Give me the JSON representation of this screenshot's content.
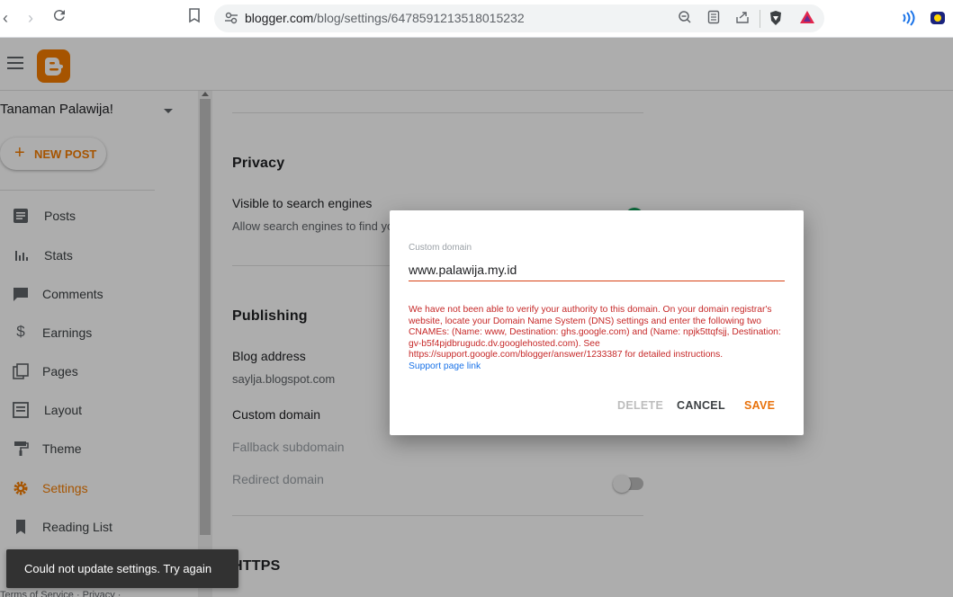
{
  "browser": {
    "url_host": "blogger.com",
    "url_path": "/blog/settings/6478591213518015232"
  },
  "sidebar": {
    "blog_name": "Tanaman Palawija!",
    "new_post_label": "NEW POST",
    "items": [
      {
        "label": "Posts",
        "icon": "posts-icon"
      },
      {
        "label": "Stats",
        "icon": "stats-icon"
      },
      {
        "label": "Comments",
        "icon": "comments-icon"
      },
      {
        "label": "Earnings",
        "icon": "dollar-icon"
      },
      {
        "label": "Pages",
        "icon": "pages-icon"
      },
      {
        "label": "Layout",
        "icon": "layout-icon"
      },
      {
        "label": "Theme",
        "icon": "paint-roller-icon"
      },
      {
        "label": "Settings",
        "icon": "gear-icon",
        "active": true
      },
      {
        "label": "Reading List",
        "icon": "bookmark-icon"
      }
    ],
    "footer": "Terms of Service · Privacy ·"
  },
  "settings": {
    "privacy": {
      "title": "Privacy",
      "visible_label": "Visible to search engines",
      "visible_sub": "Allow search engines to find your blog",
      "visible_on": true
    },
    "publishing": {
      "title": "Publishing",
      "blog_address_label": "Blog address",
      "blog_address_value": "saylja.blogspot.com",
      "custom_domain_label": "Custom domain",
      "fallback_label": "Fallback subdomain",
      "redirect_label": "Redirect domain",
      "redirect_on": false
    },
    "https_title": "HTTPS"
  },
  "dialog": {
    "field_label": "Custom domain",
    "field_value": "www.palawija.my.id",
    "error_message": "We have not been able to verify your authority to this domain. On your domain registrar's website, locate your Domain Name System (DNS) settings and enter the following two CNAMEs: (Name: www, Destination: ghs.google.com) and (Name: npjk5ttqfsjj, Destination: gv-b5f4pjdbrugudc.dv.googlehosted.com). See https://support.google.com/blogger/answer/1233387 for detailed instructions.",
    "support_link": "Support page link",
    "delete_label": "DELETE",
    "cancel_label": "CANCEL",
    "save_label": "SAVE"
  },
  "snackbar": {
    "message": "Could not update settings. Try again"
  },
  "colors": {
    "accent": "#f57d00",
    "error": "#c62828",
    "link": "#1a73e8"
  }
}
